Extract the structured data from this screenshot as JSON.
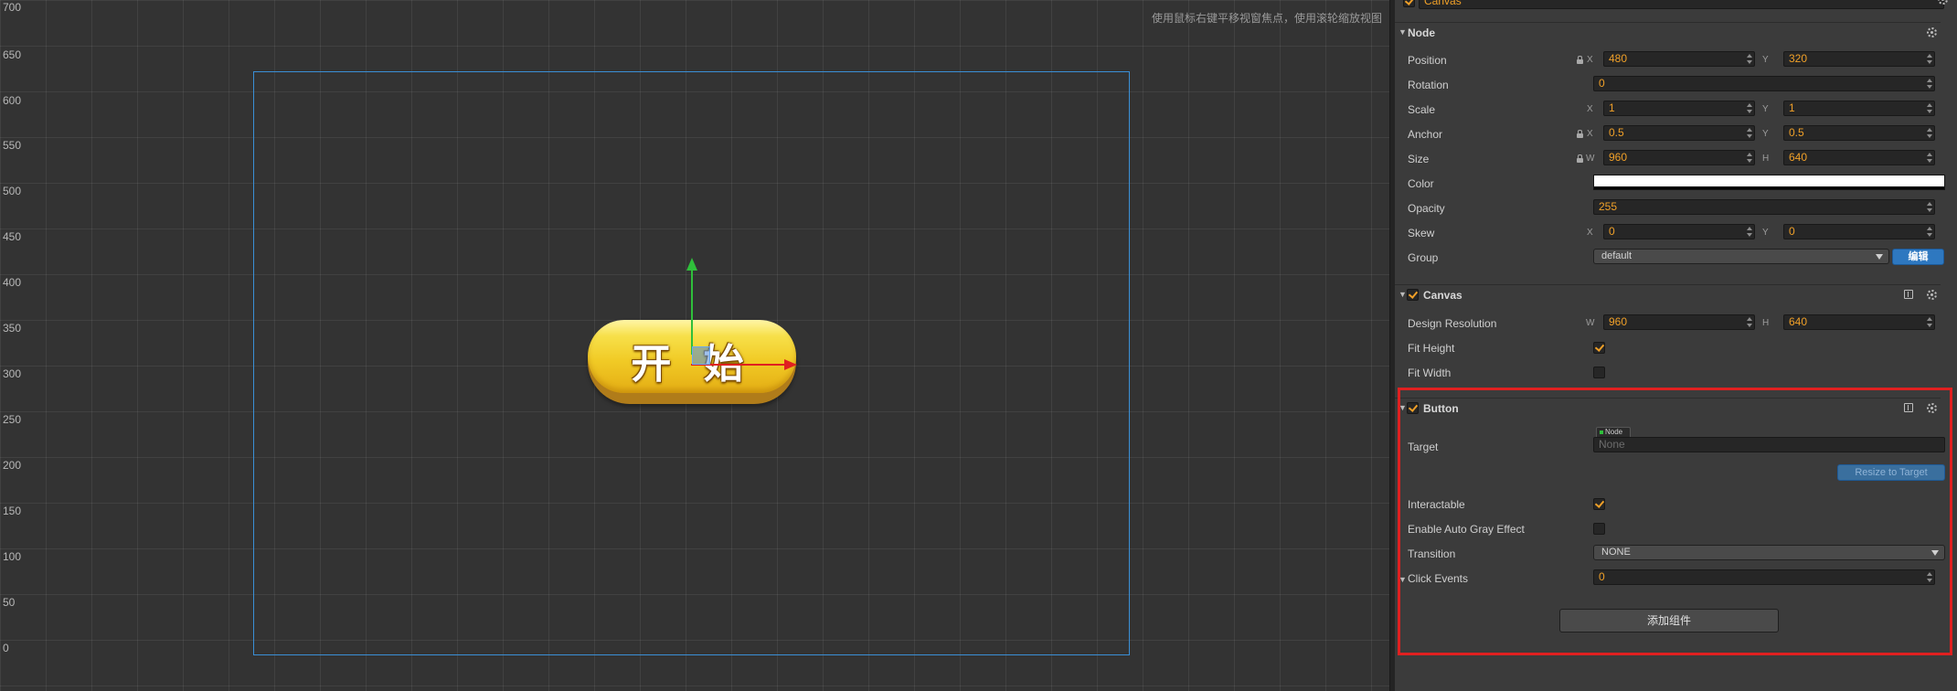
{
  "scene": {
    "hint": "使用鼠标右键平移视窗焦点，使用滚轮缩放视图",
    "y_axis_labels": [
      "700",
      "650",
      "600",
      "550",
      "500",
      "450",
      "400",
      "350",
      "300",
      "250",
      "200",
      "150",
      "100",
      "50",
      "0"
    ],
    "start_button_label": "开 始"
  },
  "inspector": {
    "node_name": "Canvas",
    "node_section": {
      "title": "Node",
      "position": {
        "label": "Position",
        "x": "480",
        "y": "320"
      },
      "rotation": {
        "label": "Rotation",
        "value": "0"
      },
      "scale": {
        "label": "Scale",
        "x": "1",
        "y": "1"
      },
      "anchor": {
        "label": "Anchor",
        "x": "0.5",
        "y": "0.5"
      },
      "size": {
        "label": "Size",
        "w": "960",
        "h": "640"
      },
      "color": {
        "label": "Color",
        "value": "#ffffff"
      },
      "opacity": {
        "label": "Opacity",
        "value": "255"
      },
      "skew": {
        "label": "Skew",
        "x": "0",
        "y": "0"
      },
      "group": {
        "label": "Group",
        "value": "default",
        "edit_label": "编辑"
      }
    },
    "canvas_section": {
      "title": "Canvas",
      "design_resolution": {
        "label": "Design Resolution",
        "w": "960",
        "h": "640"
      },
      "fit_height": {
        "label": "Fit Height",
        "checked": true
      },
      "fit_width": {
        "label": "Fit Width",
        "checked": false
      }
    },
    "button_section": {
      "title": "Button",
      "target": {
        "label": "Target",
        "tag": "Node",
        "value": "None"
      },
      "resize_label": "Resize to Target",
      "interactable": {
        "label": "Interactable",
        "checked": true
      },
      "auto_gray": {
        "label": "Enable Auto Gray Effect",
        "checked": false
      },
      "transition": {
        "label": "Transition",
        "value": "NONE"
      },
      "click_events": {
        "label": "Click Events",
        "value": "0"
      }
    },
    "add_component_label": "添加组件",
    "axis": {
      "x": "X",
      "y": "Y",
      "w": "W",
      "h": "H"
    }
  },
  "colors": {
    "accent_orange": "#f0a028",
    "highlight_red": "#e02020",
    "frame_blue": "#3a8fd6"
  }
}
